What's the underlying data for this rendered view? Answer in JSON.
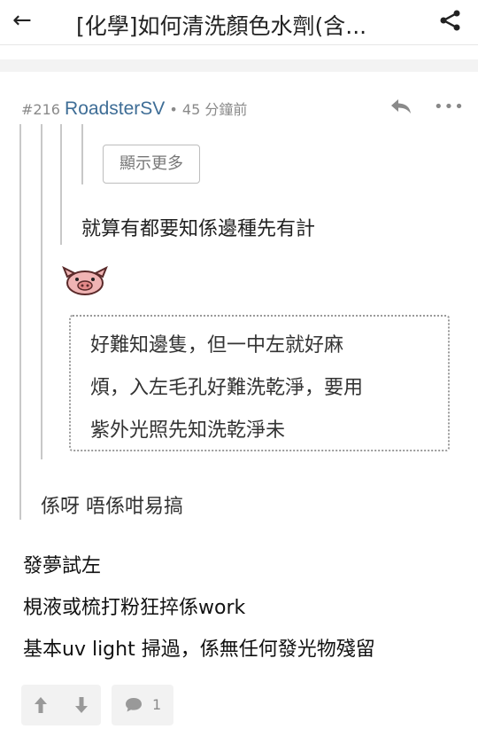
{
  "header": {
    "title": "[化學]如何清洗顏色水劑(含...",
    "back_icon": "back-arrow-icon",
    "share_icon": "share-icon"
  },
  "post": {
    "number": "#216",
    "author": "RoadsterSV",
    "separator": "•",
    "time": "45 分鐘前",
    "reply_icon": "reply-icon",
    "more_icon": "more-icon"
  },
  "quotes": {
    "show_more_label": "顯示更多",
    "level2_text": "就算有都要知係邊種先有計",
    "emoji_name": "pig-emoticon",
    "dotted_lines": [
      "好難知邊隻，但一中左就好麻",
      "煩，入左毛孔好難洗乾淨，要用",
      "紫外光照先知洗乾淨未"
    ],
    "level1_text": "係呀 唔係咁易搞"
  },
  "body": {
    "lines": [
      "發夢試左",
      "梘液或梳打粉狂捽係work",
      "基本uv light 掃過，係無任何發光物殘留"
    ]
  },
  "actions": {
    "upvote_icon": "arrow-up-icon",
    "downvote_icon": "arrow-down-icon",
    "comment_icon": "comment-icon",
    "comment_count": "1"
  }
}
